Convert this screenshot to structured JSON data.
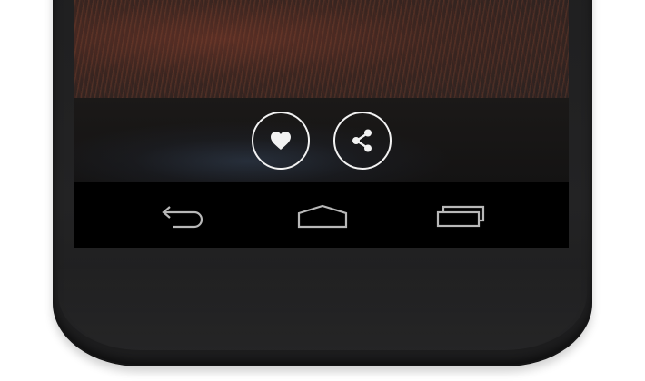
{
  "device": {
    "name": "android-phone"
  },
  "actions": [
    {
      "id": "like",
      "icon": "heart-icon"
    },
    {
      "id": "share",
      "icon": "share-icon"
    }
  ],
  "navigation_bar": {
    "buttons": [
      {
        "id": "back",
        "icon": "back-arrow-icon"
      },
      {
        "id": "home",
        "icon": "home-icon"
      },
      {
        "id": "recents",
        "icon": "recent-apps-icon"
      }
    ]
  },
  "colors": {
    "icon_stroke": "#f2f2f2",
    "nav_icon_stroke": "#b8b8b8",
    "navbar_background": "#000000",
    "phone_body": "#222223"
  }
}
